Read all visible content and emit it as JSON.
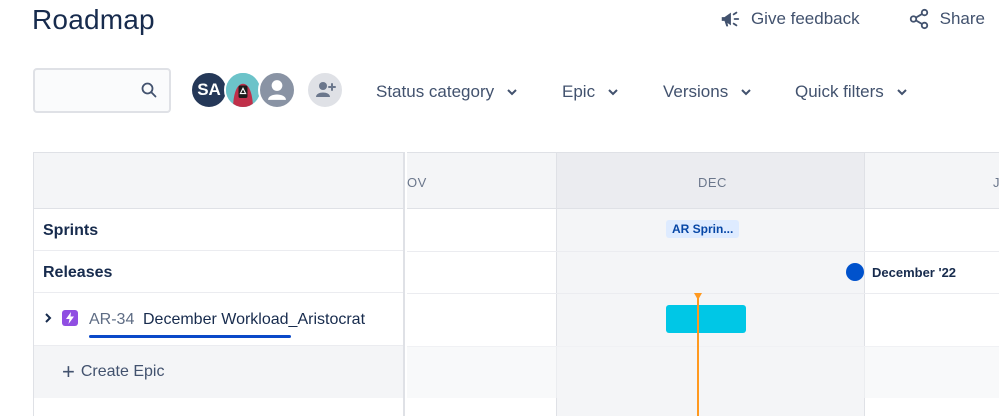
{
  "page": {
    "title": "Roadmap"
  },
  "actions": {
    "feedback_label": "Give feedback",
    "share_label": "Share"
  },
  "search": {
    "value": "",
    "placeholder": ""
  },
  "avatars": [
    {
      "initials": "SA",
      "kind": "initials"
    },
    {
      "initials": "",
      "kind": "photo"
    },
    {
      "initials": "",
      "kind": "default"
    }
  ],
  "filters": [
    {
      "label": "Status category"
    },
    {
      "label": "Epic"
    },
    {
      "label": "Versions"
    },
    {
      "label": "Quick filters"
    }
  ],
  "timeline": {
    "months": [
      "OV",
      "DEC",
      "J"
    ],
    "rows": {
      "sprints_label": "Sprints",
      "releases_label": "Releases"
    },
    "sprint_chip": "AR Sprin...",
    "release_label": "December '22"
  },
  "epic": {
    "key": "AR-34",
    "summary": "December Workload_Aristocrat"
  },
  "create": {
    "label": "Create Epic"
  },
  "colors": {
    "epic_purple": "#904ee2",
    "bar_cyan": "#00c7e6",
    "today_orange": "#ff991f",
    "release_blue": "#0052cc",
    "underline_blue": "#0a49c9"
  }
}
